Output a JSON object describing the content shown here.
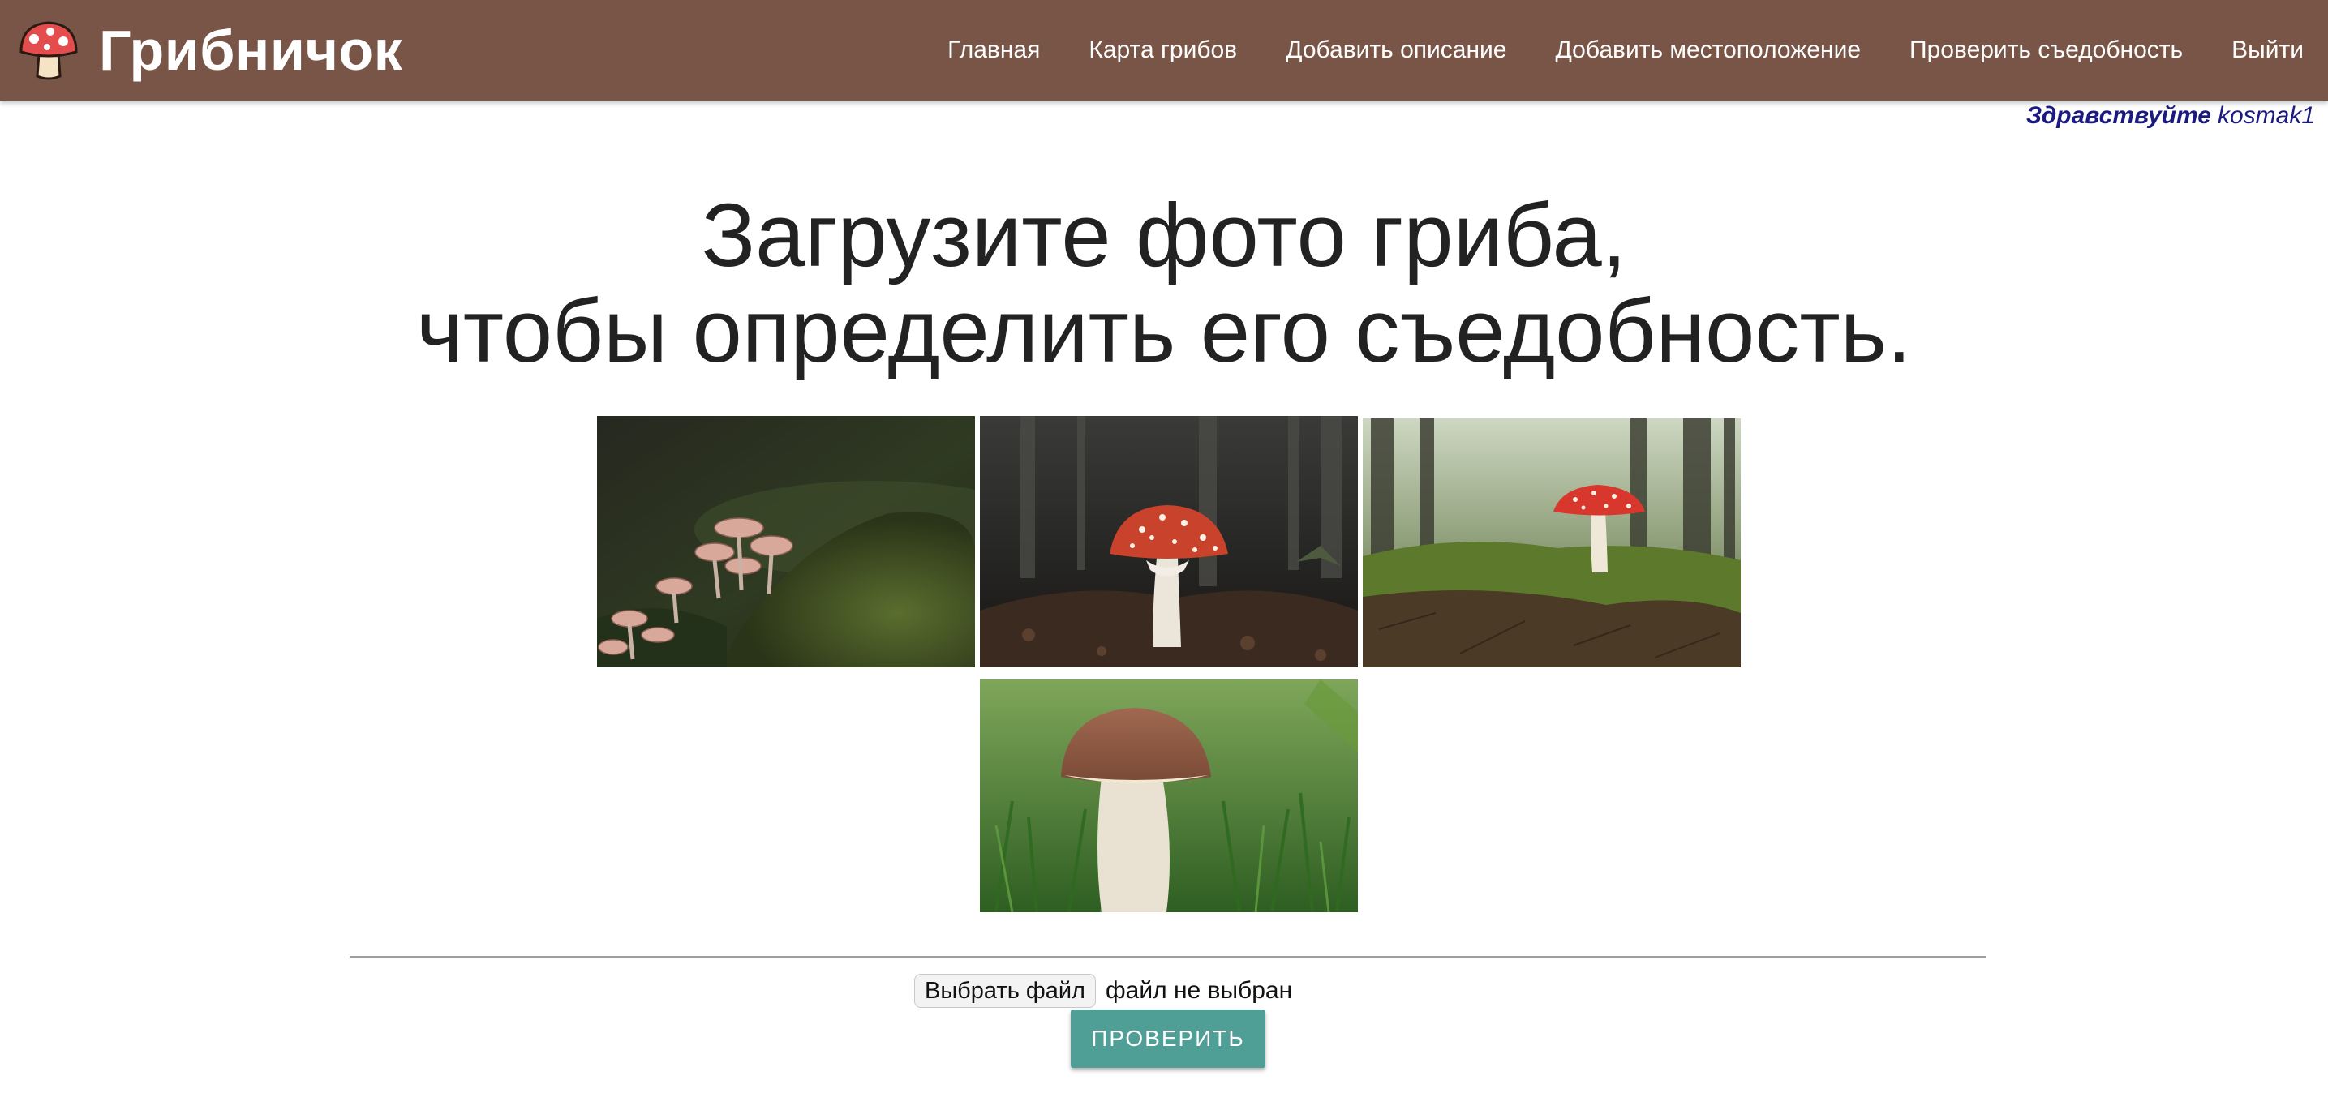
{
  "header": {
    "brand_name": "Грибничок",
    "logo_icon": "mushroom-logo-icon",
    "background_color": "#795548",
    "nav": [
      {
        "label": "Главная"
      },
      {
        "label": "Карта грибов"
      },
      {
        "label": "Добавить описание"
      },
      {
        "label": "Добавить местоположение"
      },
      {
        "label": "Проверить съедобность"
      },
      {
        "label": "Выйти"
      }
    ]
  },
  "greeting": {
    "prefix": "Здравствуйте",
    "username": "kosmak1",
    "color": "#1a1a80"
  },
  "main": {
    "title_line1": "Загрузите фото гриба,",
    "title_line2": "чтобы определить его съедобность.",
    "gallery": [
      {
        "subject": "mushroom-cluster-on-moss-photo"
      },
      {
        "subject": "fly-agaric-dark-forest-photo"
      },
      {
        "subject": "fly-agaric-on-moss-photo"
      },
      {
        "subject": "porcini-in-grass-photo"
      }
    ]
  },
  "upload": {
    "choose_file_label": "Выбрать файл",
    "file_status": "файл не выбран",
    "submit_label": "ПРОВЕРИТЬ",
    "submit_color": "#4f9f97"
  }
}
